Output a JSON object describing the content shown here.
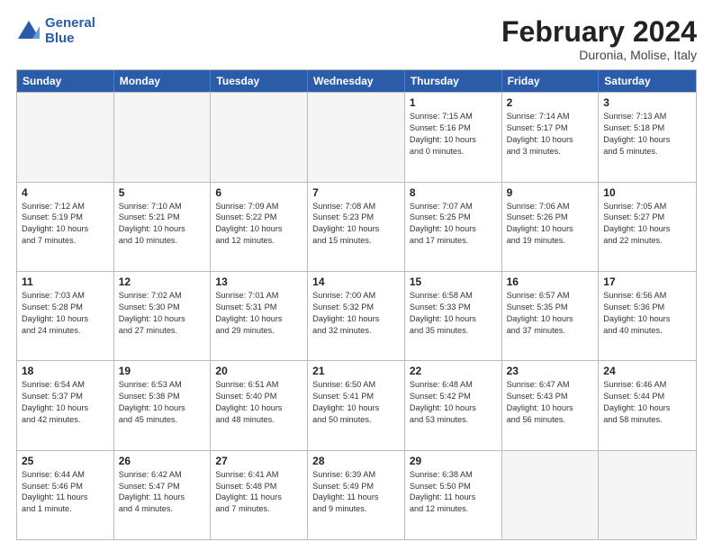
{
  "header": {
    "logo_line1": "General",
    "logo_line2": "Blue",
    "month": "February 2024",
    "location": "Duronia, Molise, Italy"
  },
  "weekdays": [
    "Sunday",
    "Monday",
    "Tuesday",
    "Wednesday",
    "Thursday",
    "Friday",
    "Saturday"
  ],
  "rows": [
    [
      {
        "day": "",
        "lines": [],
        "empty": true
      },
      {
        "day": "",
        "lines": [],
        "empty": true
      },
      {
        "day": "",
        "lines": [],
        "empty": true
      },
      {
        "day": "",
        "lines": [],
        "empty": true
      },
      {
        "day": "1",
        "lines": [
          "Sunrise: 7:15 AM",
          "Sunset: 5:16 PM",
          "Daylight: 10 hours",
          "and 0 minutes."
        ],
        "empty": false
      },
      {
        "day": "2",
        "lines": [
          "Sunrise: 7:14 AM",
          "Sunset: 5:17 PM",
          "Daylight: 10 hours",
          "and 3 minutes."
        ],
        "empty": false
      },
      {
        "day": "3",
        "lines": [
          "Sunrise: 7:13 AM",
          "Sunset: 5:18 PM",
          "Daylight: 10 hours",
          "and 5 minutes."
        ],
        "empty": false
      }
    ],
    [
      {
        "day": "4",
        "lines": [
          "Sunrise: 7:12 AM",
          "Sunset: 5:19 PM",
          "Daylight: 10 hours",
          "and 7 minutes."
        ],
        "empty": false
      },
      {
        "day": "5",
        "lines": [
          "Sunrise: 7:10 AM",
          "Sunset: 5:21 PM",
          "Daylight: 10 hours",
          "and 10 minutes."
        ],
        "empty": false
      },
      {
        "day": "6",
        "lines": [
          "Sunrise: 7:09 AM",
          "Sunset: 5:22 PM",
          "Daylight: 10 hours",
          "and 12 minutes."
        ],
        "empty": false
      },
      {
        "day": "7",
        "lines": [
          "Sunrise: 7:08 AM",
          "Sunset: 5:23 PM",
          "Daylight: 10 hours",
          "and 15 minutes."
        ],
        "empty": false
      },
      {
        "day": "8",
        "lines": [
          "Sunrise: 7:07 AM",
          "Sunset: 5:25 PM",
          "Daylight: 10 hours",
          "and 17 minutes."
        ],
        "empty": false
      },
      {
        "day": "9",
        "lines": [
          "Sunrise: 7:06 AM",
          "Sunset: 5:26 PM",
          "Daylight: 10 hours",
          "and 19 minutes."
        ],
        "empty": false
      },
      {
        "day": "10",
        "lines": [
          "Sunrise: 7:05 AM",
          "Sunset: 5:27 PM",
          "Daylight: 10 hours",
          "and 22 minutes."
        ],
        "empty": false
      }
    ],
    [
      {
        "day": "11",
        "lines": [
          "Sunrise: 7:03 AM",
          "Sunset: 5:28 PM",
          "Daylight: 10 hours",
          "and 24 minutes."
        ],
        "empty": false
      },
      {
        "day": "12",
        "lines": [
          "Sunrise: 7:02 AM",
          "Sunset: 5:30 PM",
          "Daylight: 10 hours",
          "and 27 minutes."
        ],
        "empty": false
      },
      {
        "day": "13",
        "lines": [
          "Sunrise: 7:01 AM",
          "Sunset: 5:31 PM",
          "Daylight: 10 hours",
          "and 29 minutes."
        ],
        "empty": false
      },
      {
        "day": "14",
        "lines": [
          "Sunrise: 7:00 AM",
          "Sunset: 5:32 PM",
          "Daylight: 10 hours",
          "and 32 minutes."
        ],
        "empty": false
      },
      {
        "day": "15",
        "lines": [
          "Sunrise: 6:58 AM",
          "Sunset: 5:33 PM",
          "Daylight: 10 hours",
          "and 35 minutes."
        ],
        "empty": false
      },
      {
        "day": "16",
        "lines": [
          "Sunrise: 6:57 AM",
          "Sunset: 5:35 PM",
          "Daylight: 10 hours",
          "and 37 minutes."
        ],
        "empty": false
      },
      {
        "day": "17",
        "lines": [
          "Sunrise: 6:56 AM",
          "Sunset: 5:36 PM",
          "Daylight: 10 hours",
          "and 40 minutes."
        ],
        "empty": false
      }
    ],
    [
      {
        "day": "18",
        "lines": [
          "Sunrise: 6:54 AM",
          "Sunset: 5:37 PM",
          "Daylight: 10 hours",
          "and 42 minutes."
        ],
        "empty": false
      },
      {
        "day": "19",
        "lines": [
          "Sunrise: 6:53 AM",
          "Sunset: 5:38 PM",
          "Daylight: 10 hours",
          "and 45 minutes."
        ],
        "empty": false
      },
      {
        "day": "20",
        "lines": [
          "Sunrise: 6:51 AM",
          "Sunset: 5:40 PM",
          "Daylight: 10 hours",
          "and 48 minutes."
        ],
        "empty": false
      },
      {
        "day": "21",
        "lines": [
          "Sunrise: 6:50 AM",
          "Sunset: 5:41 PM",
          "Daylight: 10 hours",
          "and 50 minutes."
        ],
        "empty": false
      },
      {
        "day": "22",
        "lines": [
          "Sunrise: 6:48 AM",
          "Sunset: 5:42 PM",
          "Daylight: 10 hours",
          "and 53 minutes."
        ],
        "empty": false
      },
      {
        "day": "23",
        "lines": [
          "Sunrise: 6:47 AM",
          "Sunset: 5:43 PM",
          "Daylight: 10 hours",
          "and 56 minutes."
        ],
        "empty": false
      },
      {
        "day": "24",
        "lines": [
          "Sunrise: 6:46 AM",
          "Sunset: 5:44 PM",
          "Daylight: 10 hours",
          "and 58 minutes."
        ],
        "empty": false
      }
    ],
    [
      {
        "day": "25",
        "lines": [
          "Sunrise: 6:44 AM",
          "Sunset: 5:46 PM",
          "Daylight: 11 hours",
          "and 1 minute."
        ],
        "empty": false
      },
      {
        "day": "26",
        "lines": [
          "Sunrise: 6:42 AM",
          "Sunset: 5:47 PM",
          "Daylight: 11 hours",
          "and 4 minutes."
        ],
        "empty": false
      },
      {
        "day": "27",
        "lines": [
          "Sunrise: 6:41 AM",
          "Sunset: 5:48 PM",
          "Daylight: 11 hours",
          "and 7 minutes."
        ],
        "empty": false
      },
      {
        "day": "28",
        "lines": [
          "Sunrise: 6:39 AM",
          "Sunset: 5:49 PM",
          "Daylight: 11 hours",
          "and 9 minutes."
        ],
        "empty": false
      },
      {
        "day": "29",
        "lines": [
          "Sunrise: 6:38 AM",
          "Sunset: 5:50 PM",
          "Daylight: 11 hours",
          "and 12 minutes."
        ],
        "empty": false
      },
      {
        "day": "",
        "lines": [],
        "empty": true
      },
      {
        "day": "",
        "lines": [],
        "empty": true
      }
    ]
  ]
}
